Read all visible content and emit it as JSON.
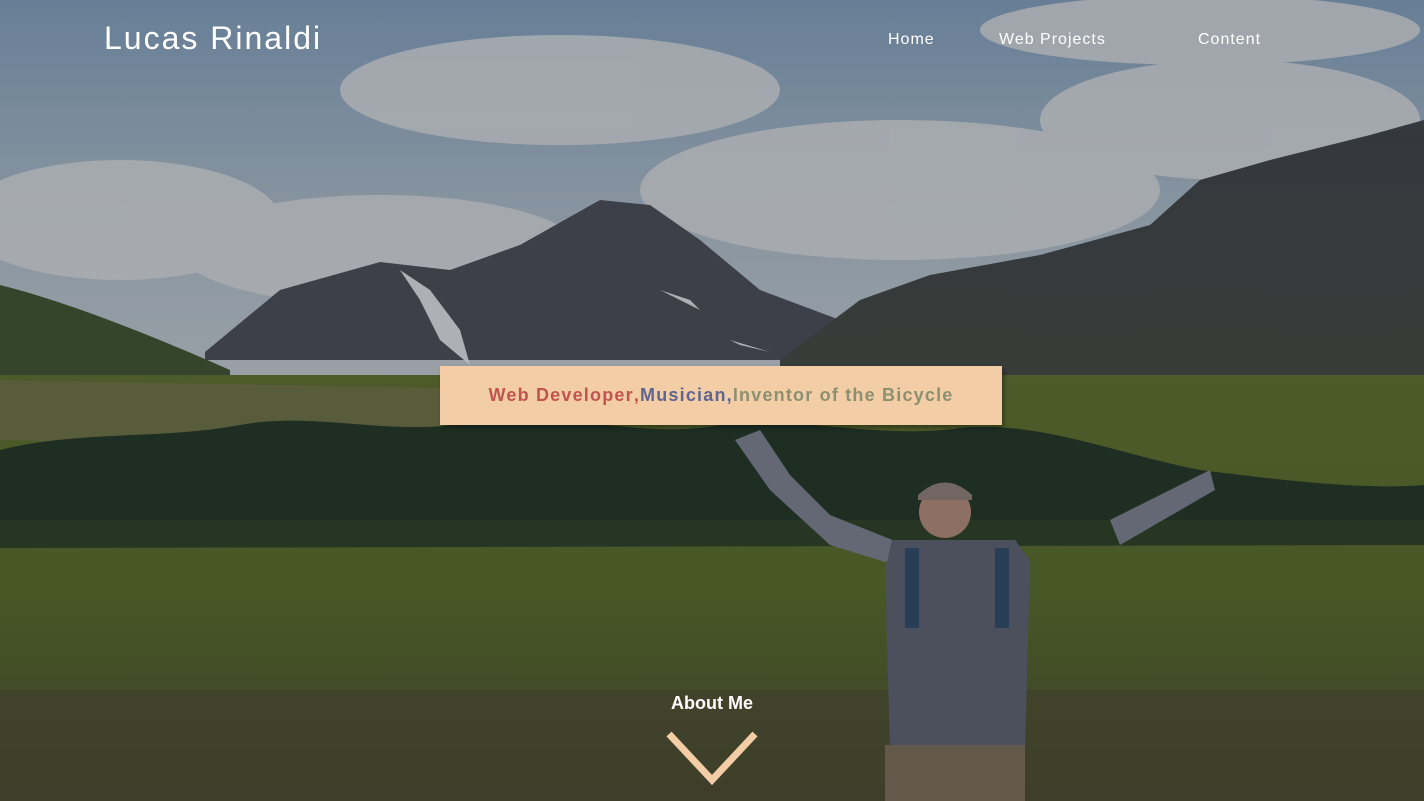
{
  "header": {
    "site_title": "Lucas Rinaldi",
    "nav": [
      "Home",
      "Web Projects",
      "Content"
    ]
  },
  "hero": {
    "tagline_parts": [
      "Web Developer",
      "Musician",
      "Inventor of the Bicycle"
    ],
    "tagline_separator": ", ",
    "scroll_label": "About Me",
    "scroll_icon": "chevron-down-icon"
  },
  "colors": {
    "accent_peach": "#f3cda6",
    "tag_red": "#c25450",
    "tag_blue": "#5e6690",
    "tag_olive": "#8b9070"
  }
}
